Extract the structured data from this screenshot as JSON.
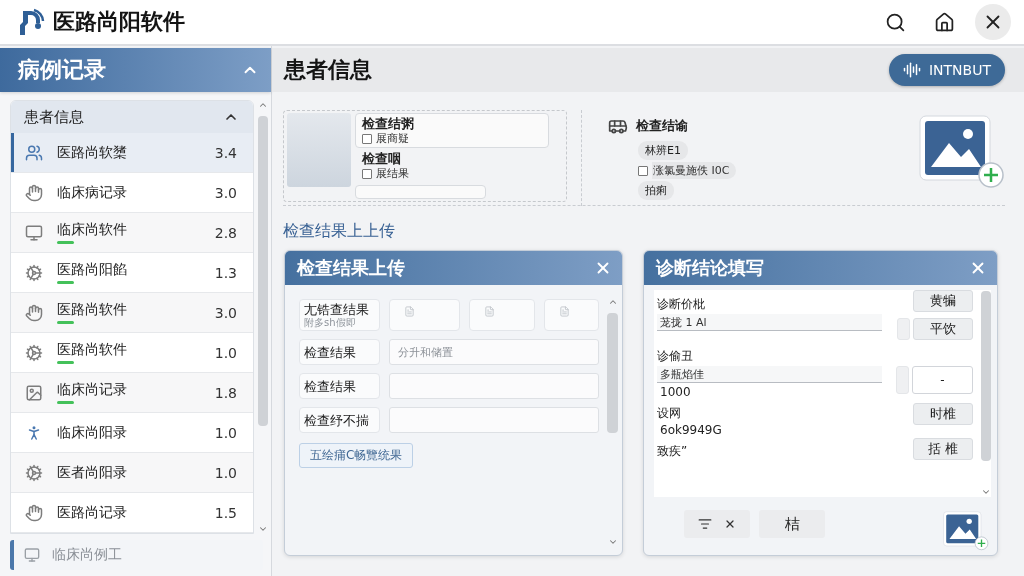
{
  "app": {
    "title": "医路尚阳软件"
  },
  "sidebar": {
    "title": "病例记录",
    "group": {
      "label": "患者信息",
      "expanded": true
    },
    "items": [
      {
        "label": "医路尚软橥",
        "value": "3.4",
        "selected": true,
        "flagged": false
      },
      {
        "label": "临床病记录",
        "value": "3.0",
        "selected": false,
        "flagged": false
      },
      {
        "label": "临床尚软件",
        "value": "2.8",
        "selected": false,
        "flagged": true
      },
      {
        "label": "医路尚阳餡",
        "value": "1.3",
        "selected": false,
        "flagged": true
      },
      {
        "label": "医路尚软件",
        "value": "3.0",
        "selected": false,
        "flagged": true
      },
      {
        "label": "医路尚软件",
        "value": "1.0",
        "selected": false,
        "flagged": true
      },
      {
        "label": "临床尚记录",
        "value": "1.8",
        "selected": false,
        "flagged": true
      },
      {
        "label": "临床尚阳录",
        "value": "1.0",
        "selected": false,
        "flagged": false
      },
      {
        "label": "医者尚阳录",
        "value": "1.0",
        "selected": false,
        "flagged": false
      },
      {
        "label": "医路尚记录",
        "value": "1.5",
        "selected": false,
        "flagged": false
      }
    ],
    "footer_item": {
      "label": "临床尚例工"
    }
  },
  "main": {
    "title": "患者信息",
    "action_button": "INTNBUT"
  },
  "patient": {
    "fields": [
      {
        "label": "检查结粥",
        "option": {
          "label": "展商疑",
          "checked": false
        }
      },
      {
        "label": "检查咽",
        "option": {
          "label": "展结果",
          "checked": false
        }
      }
    ],
    "findings": {
      "title": "检查结谕",
      "tags": [
        {
          "kind": "tag",
          "label": "林辨E1"
        },
        {
          "kind": "checkbox",
          "label": "涨氯曼施佚 I0C",
          "checked": false
        },
        {
          "kind": "tag",
          "label": "拍痢"
        }
      ]
    }
  },
  "upload": {
    "heading": "检查结果上上传",
    "panel": {
      "title": "检查结果上传",
      "rows": [
        {
          "kind": "slots",
          "label": "尢锆查结果",
          "sublabel": "附多sh假即"
        },
        {
          "kind": "input",
          "label": "检查结果",
          "placeholder": "分升和储置"
        },
        {
          "kind": "input",
          "label": "检查结果"
        },
        {
          "kind": "input",
          "label": "检查纾不揣"
        }
      ],
      "link": "五绘痡C畅覽统果"
    }
  },
  "diagnosis": {
    "title": "诊断结论填写",
    "fields": [
      {
        "label": "诊断价枇",
        "value": "茏拢 1 Al"
      },
      {
        "label": "诊偷丑",
        "value": "多瓶焰佳",
        "note": "1000"
      },
      {
        "label": "设网",
        "note": "6ok9949G"
      },
      {
        "label": "致疾”"
      }
    ],
    "side_controls": [
      {
        "kind": "button",
        "label": "黄犏",
        "tab": false
      },
      {
        "kind": "button",
        "label": "平饮",
        "tab": true
      },
      {
        "kind": "field",
        "value": "-",
        "tab": true
      },
      {
        "kind": "button",
        "label": "时椎",
        "tab": false
      },
      {
        "kind": "button",
        "label": "括 椎",
        "tab": false
      }
    ],
    "footer_buttons": [
      {
        "kind": "icons"
      },
      {
        "kind": "text",
        "label": "桔"
      }
    ]
  }
}
